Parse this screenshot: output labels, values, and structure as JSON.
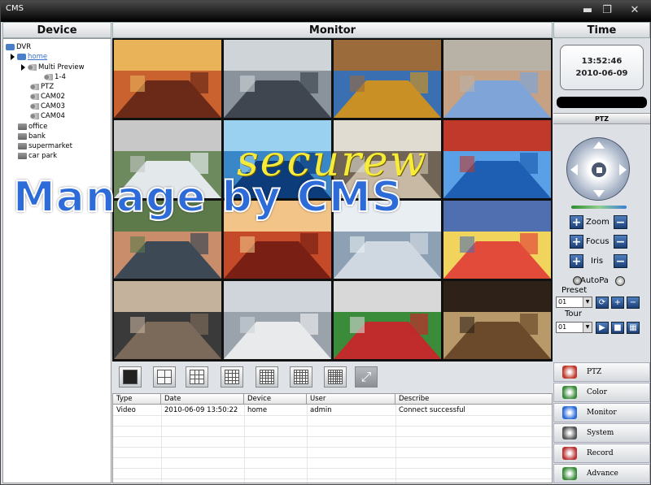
{
  "window": {
    "title": "CMS"
  },
  "headers": {
    "device": "Device",
    "monitor": "Monitor",
    "time": "Time"
  },
  "tree": {
    "root": "DVR",
    "home": "home",
    "multi_preview": "Multi Preview",
    "range": "1-4",
    "cams": [
      "PTZ",
      "CAM02",
      "CAM03",
      "CAM04"
    ],
    "groups": [
      "office",
      "bank",
      "supermarket",
      "car park"
    ]
  },
  "overlay": {
    "brand": "securew",
    "slogan": "Manage by CMS"
  },
  "log": {
    "columns": [
      "Type",
      "Date",
      "Device",
      "User",
      "Describe"
    ],
    "rows": [
      {
        "type": "Video",
        "date": "2010-06-09 13:50:22",
        "device": "home",
        "user": "admin",
        "describe": "Connect successful"
      }
    ]
  },
  "clock": {
    "time": "13:52:46",
    "date": "2010-06-09"
  },
  "ptz": {
    "title": "PTZ",
    "zoom": "Zoom",
    "focus": "Focus",
    "iris": "Iris",
    "auto": "AutoPa",
    "preset": "Preset",
    "preset_value": "01",
    "tour": "Tour",
    "tour_value": "01"
  },
  "nav": [
    {
      "label": "PTZ",
      "icon": "ptz-icon"
    },
    {
      "label": "Color",
      "icon": "color-icon"
    },
    {
      "label": "Monitor",
      "icon": "monitor-icon"
    },
    {
      "label": "System",
      "icon": "system-icon"
    },
    {
      "label": "Record",
      "icon": "record-icon"
    },
    {
      "label": "Advance",
      "icon": "advance-icon"
    }
  ],
  "colors": {
    "accent": "#2d6bd8",
    "watermark_yellow": "#f6ea3a"
  }
}
